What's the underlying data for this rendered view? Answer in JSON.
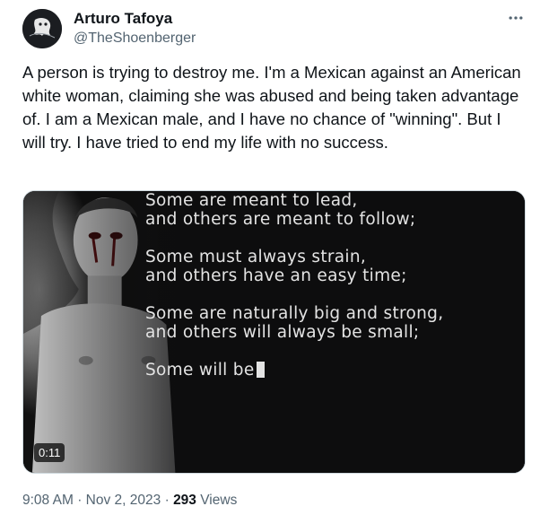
{
  "author": {
    "name": "Arturo Tafoya",
    "handle": "@TheShoenberger"
  },
  "tweet": {
    "text": "A person is trying to destroy me. I'm a Mexican against an American white woman, claiming she was abused and being taken advantage of. I am a Mexican male, and I have no chance of \"winning\". But I will try. I have tried to end my life with no success."
  },
  "media": {
    "poem": [
      [
        "Some are meant to lead,",
        "and others are meant to follow;"
      ],
      [
        "Some must always strain,",
        "and others have an easy time;"
      ],
      [
        "Some are naturally big and strong,",
        "and others will always be small;"
      ],
      [
        "Some will be"
      ]
    ],
    "duration": "0:11"
  },
  "meta": {
    "time": "9:08 AM",
    "separator": "·",
    "date": "Nov 2, 2023",
    "views_count": "293",
    "views_label": "Views"
  },
  "icons": {
    "more": "more-horizontal-icon"
  }
}
